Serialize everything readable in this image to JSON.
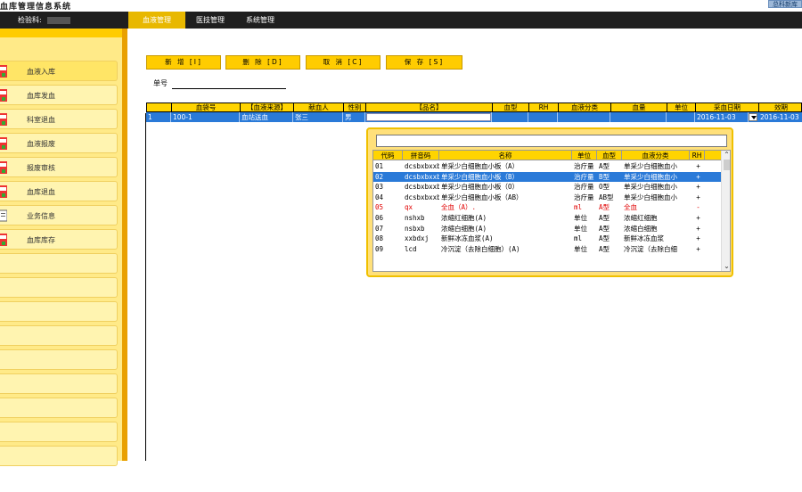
{
  "title_bar": {
    "app_title": "血库管理信息系统",
    "corner_label": "总科新库"
  },
  "topbar": {
    "dept_label": "检验科:",
    "tabs": [
      "血液管理",
      "医技管理",
      "系统管理"
    ]
  },
  "sidebar": {
    "items": [
      "血液入库",
      "血库发血",
      "科室退血",
      "血液报废",
      "报废审核",
      "血库退血",
      "业务信息",
      "血库库存"
    ]
  },
  "toolbar": {
    "buttons": [
      "新 增 [I]",
      "删 除 [D]",
      "取 消 [C]",
      "保 存 [S]"
    ]
  },
  "form": {
    "danhao_label": "单号"
  },
  "grid": {
    "headers": [
      "血袋号",
      "【血液来源】",
      "献血人",
      "性别",
      "【品名】",
      "血型",
      "RH",
      "血液分类",
      "血量",
      "单位",
      "采血日期",
      "效期"
    ],
    "row": {
      "index": "1",
      "xuedaihao": "100-1",
      "source": "血站送血",
      "donor": "张三",
      "gender": "男",
      "caixue_date": "2016-11-03",
      "xiaoqi": "2016-11-03"
    }
  },
  "popup": {
    "headers": [
      "代码",
      "拼音码",
      "名称",
      "单位",
      "血型",
      "血液分类",
      "RH"
    ],
    "rows": [
      [
        "01",
        "dcsbxbxxb",
        "单采少白细胞血小板（A）",
        "治疗量",
        "A型",
        "单采少白细胞血小",
        "+"
      ],
      [
        "02",
        "dcsbxbxxb",
        "单采少白细胞血小板（B）",
        "治疗量",
        "B型",
        "单采少白细胞血小",
        "+"
      ],
      [
        "03",
        "dcsbxbxxb",
        "单采少白细胞血小板（O）",
        "治疗量",
        "O型",
        "单采少白细胞血小",
        "+"
      ],
      [
        "04",
        "dcsbxbxxb",
        "单采少白细胞血小板（AB）",
        "治疗量",
        "AB型",
        "单采少白细胞血小",
        "+"
      ],
      [
        "05",
        "qx",
        "全血（A）.",
        "ml",
        "A型",
        "全血",
        "-"
      ],
      [
        "06",
        "nshxb",
        "浓缩红细胞(A)",
        "单位",
        "A型",
        "浓缩红细胞",
        "+"
      ],
      [
        "07",
        "nsbxb",
        "浓缩白细胞(A)",
        "单位",
        "A型",
        "浓缩白细胞",
        "+"
      ],
      [
        "08",
        "xxbdxj",
        "新鲜冰冻血浆(A)",
        "ml",
        "A型",
        "新鲜冰冻血浆",
        "+"
      ],
      [
        "09",
        "lcd",
        "冷沉淀（去除白细胞）(A)",
        "单位",
        "A型",
        "冷沉淀（去除白细",
        "+"
      ]
    ]
  },
  "colors": {
    "accent": "#ffcc00",
    "selection": "#2a7ad8",
    "topbar": "#1f1f1f",
    "sidebar_bg": "#ffea88"
  }
}
